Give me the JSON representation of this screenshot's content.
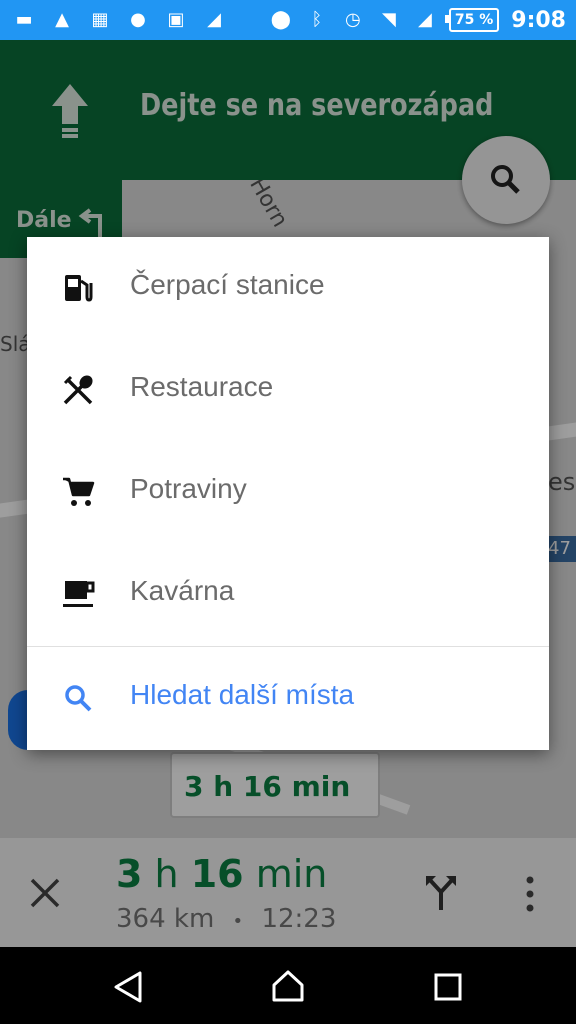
{
  "status_bar": {
    "battery": "75 %",
    "time": "9:08"
  },
  "navigation": {
    "instruction": "Dejte se na severozápad",
    "then_label": "Dále",
    "map_labels": [
      "Horn",
      "Slá",
      "es",
      "47"
    ]
  },
  "trip": {
    "duration_hours": "3",
    "duration_h_unit": "h",
    "duration_minutes": "16",
    "duration_min_unit": "min",
    "distance": "364 km",
    "separator": "•",
    "arrival": "12:23",
    "chip_label": "3 h 16 min"
  },
  "menu": {
    "items": [
      {
        "label": "Čerpací stanice",
        "icon": "gas-station-icon"
      },
      {
        "label": "Restaurace",
        "icon": "restaurant-icon"
      },
      {
        "label": "Potraviny",
        "icon": "grocery-cart-icon"
      },
      {
        "label": "Kavárna",
        "icon": "coffee-icon"
      }
    ],
    "more_places": "Hledat další místa"
  },
  "colors": {
    "status_bar": "#2196F3",
    "nav_header": "#0b6e3a",
    "eta_green": "#0b8043",
    "link_blue": "#4285f4"
  }
}
